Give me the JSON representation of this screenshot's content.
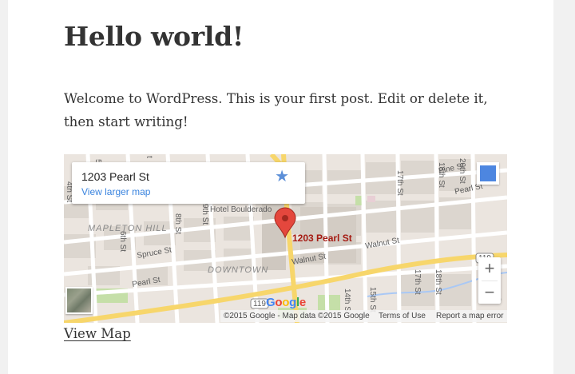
{
  "post": {
    "title": "Hello world!",
    "body": "Welcome to WordPress. This is your first post. Edit or delete it, then start writing!"
  },
  "map": {
    "info_card": {
      "place_name": "1203 Pearl St",
      "larger_map_link": "View larger map"
    },
    "marker_label": "1203 Pearl St",
    "landmark": "Hotel Boulderado",
    "districts": [
      "MAPLETON HILL",
      "DOWNTOWN"
    ],
    "streets": {
      "pine_st_right": "Pine St",
      "pearl_st_top_right": "Pearl St",
      "walnut_st_right": "Walnut St",
      "walnut_st_mid": "Walnut St",
      "spruce_st": "Spruce St",
      "pearl_st_left": "Pearl St",
      "st_top_left": "St",
      "st_near_hotel": "St",
      "st_20th": "20th St",
      "st_17th_top": "17th St",
      "st_18th_top": "18th St",
      "st_4th": "4th St",
      "st_6th": "6th St",
      "st_8th": "8th St",
      "st_9th": "9th St",
      "st_14th": "14th St",
      "st_15th": "15th St",
      "st_17th_bottom": "17th St",
      "st_18th_bottom": "18th St",
      "st_5": "5",
      "st_t": "t",
      "goo_partial": "GOO"
    },
    "highway_shields": [
      "119",
      "119"
    ],
    "zoom": {
      "in": "+",
      "out": "−"
    },
    "google_logo": [
      "G",
      "o",
      "o",
      "g",
      "l",
      "e"
    ],
    "attribution": {
      "copyright": "©2015 Google - Map data ©2015 Google",
      "terms": "Terms of Use",
      "report": "Report a map error"
    }
  },
  "view_map_link": "View Map",
  "colors": {
    "road_yellow": "#f7d66b",
    "road_white": "#ffffff",
    "land": "#ebe5df",
    "block": "#dcd6cf",
    "park": "#c5dfa8",
    "water": "#a9c8f5",
    "marker_red": "#e4473d",
    "marker_text": "#a51a12",
    "link_blue": "#3a84df"
  },
  "icons": {
    "star": "★",
    "pegman": "pegman-icon",
    "marker": "map-pin-icon"
  }
}
